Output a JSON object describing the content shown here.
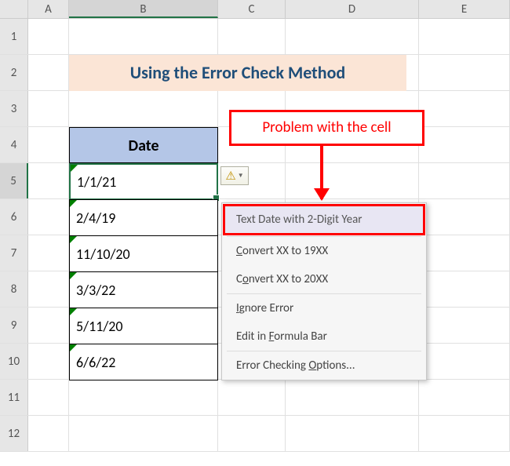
{
  "columns": [
    "A",
    "B",
    "C",
    "D",
    "E"
  ],
  "rows": [
    "1",
    "2",
    "3",
    "4",
    "5",
    "6",
    "7",
    "8",
    "9",
    "10",
    "11",
    "12"
  ],
  "active_col": "B",
  "active_row": "5",
  "title": "Using the Error Check Method",
  "table": {
    "header": "Date",
    "cells": [
      "1/1/21",
      "2/4/19",
      "11/10/20",
      "3/3/22",
      "5/11/20",
      "6/6/22"
    ]
  },
  "callout": "Problem with the cell",
  "menu": {
    "header": "Text Date with 2-Digit Year",
    "items": [
      {
        "pre": "",
        "key": "C",
        "post": "onvert XX to 19XX"
      },
      {
        "pre": "C",
        "key": "o",
        "post": "nvert XX to 20XX"
      },
      {
        "pre": "",
        "key": "I",
        "post": "gnore Error"
      },
      {
        "pre": "Edit in ",
        "key": "F",
        "post": "ormula Bar"
      },
      {
        "pre": "Error Checking ",
        "key": "O",
        "post": "ptions..."
      }
    ]
  },
  "icons": {
    "warning": "⚠",
    "dropdown": "▼"
  }
}
